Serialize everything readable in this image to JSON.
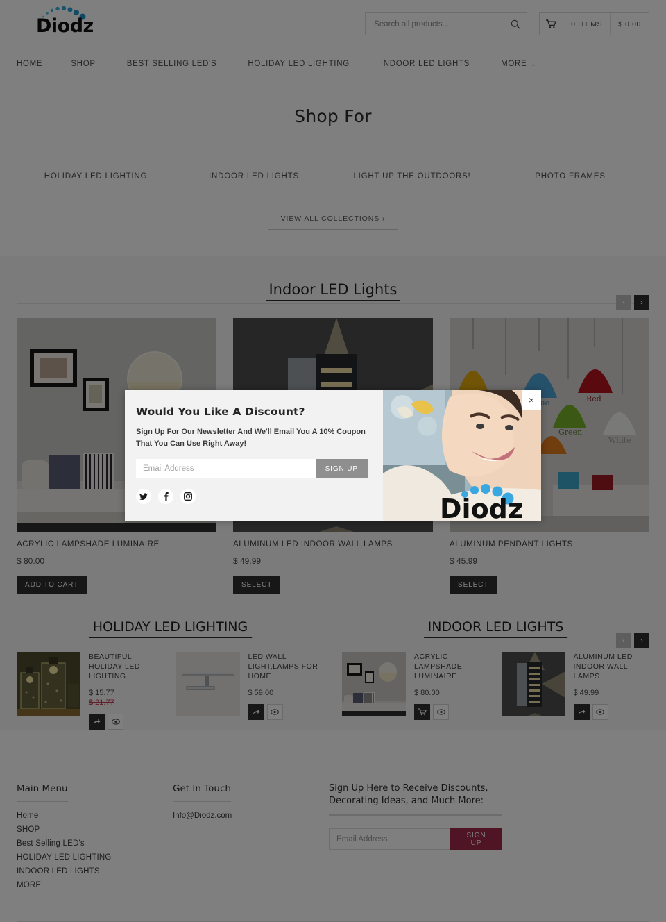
{
  "header": {
    "logo_text": "Diodz",
    "search": {
      "placeholder": "Search all products...",
      "value": "",
      "icon": "search-icon"
    },
    "cart": {
      "icon": "cart-icon",
      "items_label": "0 ITEMS",
      "total_label": "$ 0.00"
    }
  },
  "nav": {
    "items": [
      {
        "label": "HOME"
      },
      {
        "label": "SHOP"
      },
      {
        "label": "BEST SELLING LED'S"
      },
      {
        "label": "HOLIDAY LED LIGHTING"
      },
      {
        "label": "INDOOR LED LIGHTS"
      },
      {
        "label": "MORE",
        "caret": "⌄"
      }
    ]
  },
  "shop_for": {
    "title": "Shop For",
    "collections": [
      {
        "label": "HOLIDAY LED LIGHTING"
      },
      {
        "label": "INDOOR LED LIGHTS"
      },
      {
        "label": "LIGHT UP THE OUTDOORS!"
      },
      {
        "label": "PHOTO FRAMES"
      }
    ],
    "view_all_label": "VIEW ALL COLLECTIONS ›"
  },
  "featured": {
    "title": "Indoor LED Lights",
    "prev_icon": "‹",
    "next_icon": "›",
    "products": [
      {
        "title": "ACRYLIC LAMPSHADE LUMINAIRE",
        "price": "$ 80.00",
        "button": "ADD TO CART",
        "image": "living-room-wall-light"
      },
      {
        "title": "ALUMINUM LED INDOOR WALL LAMPS",
        "price": "$ 49.99",
        "button": "SELECT",
        "image": "aluminum-wall-lamp"
      },
      {
        "title": "ALUMINUM PENDANT LIGHTS",
        "price": "$ 45.99",
        "button": "SELECT",
        "image": "colored-pendant-lights"
      }
    ]
  },
  "carousels": [
    {
      "title": "HOLIDAY LED LIGHTING",
      "has_arrows": false,
      "items": [
        {
          "title": "BEAUTIFUL HOLIDAY LED LIGHTING",
          "price": "$ 15.77",
          "old_price": "$ 21.77",
          "image": "holiday-lanterns",
          "buttons": [
            "share-icon",
            "eye-icon"
          ]
        },
        {
          "title": "LED WALL LIGHT,LAMPS FOR HOME",
          "price": "$ 59.00",
          "old_price": "",
          "image": "led-wall-bar-light",
          "buttons": [
            "share-icon",
            "eye-icon"
          ]
        }
      ]
    },
    {
      "title": "INDOOR LED LIGHTS",
      "has_arrows": true,
      "prev_icon": "‹",
      "next_icon": "›",
      "items": [
        {
          "title": "ACRYLIC LAMPSHADE LUMINAIRE",
          "price": "$ 80.00",
          "old_price": "",
          "image": "living-room-wall-light",
          "buttons": [
            "cart-icon",
            "eye-icon"
          ]
        },
        {
          "title": "ALUMINUM LED INDOOR WALL LAMPS",
          "price": "$ 49.99",
          "old_price": "",
          "image": "aluminum-wall-lamp",
          "buttons": [
            "share-icon",
            "eye-icon"
          ]
        }
      ]
    }
  ],
  "footer": {
    "main_menu": {
      "heading": "Main Menu",
      "links": [
        {
          "label": "Home"
        },
        {
          "label": "SHOP"
        },
        {
          "label": "Best Selling LED's"
        },
        {
          "label": "HOLIDAY LED LIGHTING"
        },
        {
          "label": "INDOOR LED LIGHTS"
        },
        {
          "label": "MORE"
        }
      ]
    },
    "get_in_touch": {
      "heading": "Get In Touch",
      "email": "Info@Diodz.com"
    },
    "signup": {
      "heading": "Sign Up Here to Receive Discounts, Decorating Ideas, and Much More:",
      "placeholder": "Email Address",
      "value": "",
      "button": "SIGN UP",
      "button_color": "#9e2b49"
    }
  },
  "modal": {
    "heading": "Would You Like A Discount?",
    "body": "Sign Up For Our Newsletter And We'll Email You A 10% Coupon That You Can Use Right Away!",
    "placeholder": "Email Address",
    "value": "",
    "button": "SIGN UP",
    "close_icon": "×",
    "social": [
      {
        "name": "twitter-icon"
      },
      {
        "name": "facebook-icon"
      },
      {
        "name": "instagram-icon"
      }
    ],
    "image_badge_text": "Diodz"
  },
  "colors": {
    "accent_maroon": "#9e2b49",
    "logo_blue": "#29a3d9",
    "dark_button": "#2f2f2f",
    "sale_red": "#c23b52"
  }
}
